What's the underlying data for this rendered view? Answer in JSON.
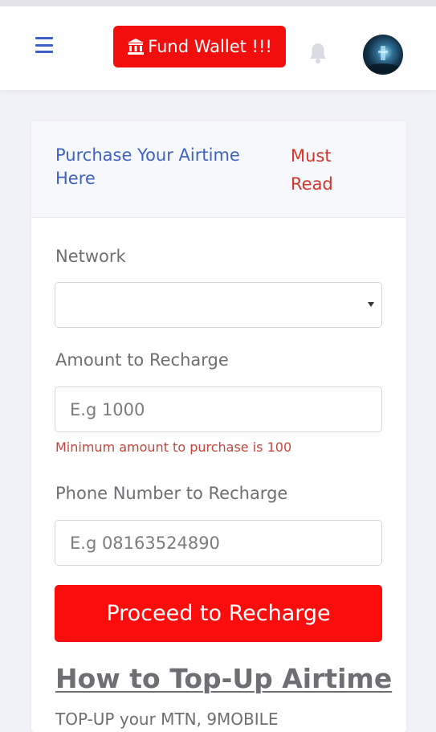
{
  "header": {
    "fund_wallet_label": "Fund Wallet !!!",
    "menu_icon": "hamburger-menu-icon",
    "bank_icon": "bank-icon",
    "bell_icon": "bell-icon",
    "avatar": "profile-avatar"
  },
  "card": {
    "title": "Purchase Your Airtime Here",
    "must_read": "Must Read"
  },
  "form": {
    "network_label": "Network",
    "network_value": "",
    "amount_label": "Amount to Recharge",
    "amount_placeholder": "E.g 1000",
    "amount_hint": "Minimum amount to purchase is 100",
    "phone_label": "Phone Number to Recharge",
    "phone_placeholder": "E.g 08163524890",
    "submit_label": "Proceed to Recharge"
  },
  "howto": {
    "title": "How to Top-Up Airtime",
    "text": "TOP-UP your MTN, 9MOBILE"
  },
  "colors": {
    "primary_red": "#f30e0e",
    "title_blue": "#3f62c2",
    "warning_red": "#d2352a",
    "page_bg": "#f1f2f7"
  }
}
